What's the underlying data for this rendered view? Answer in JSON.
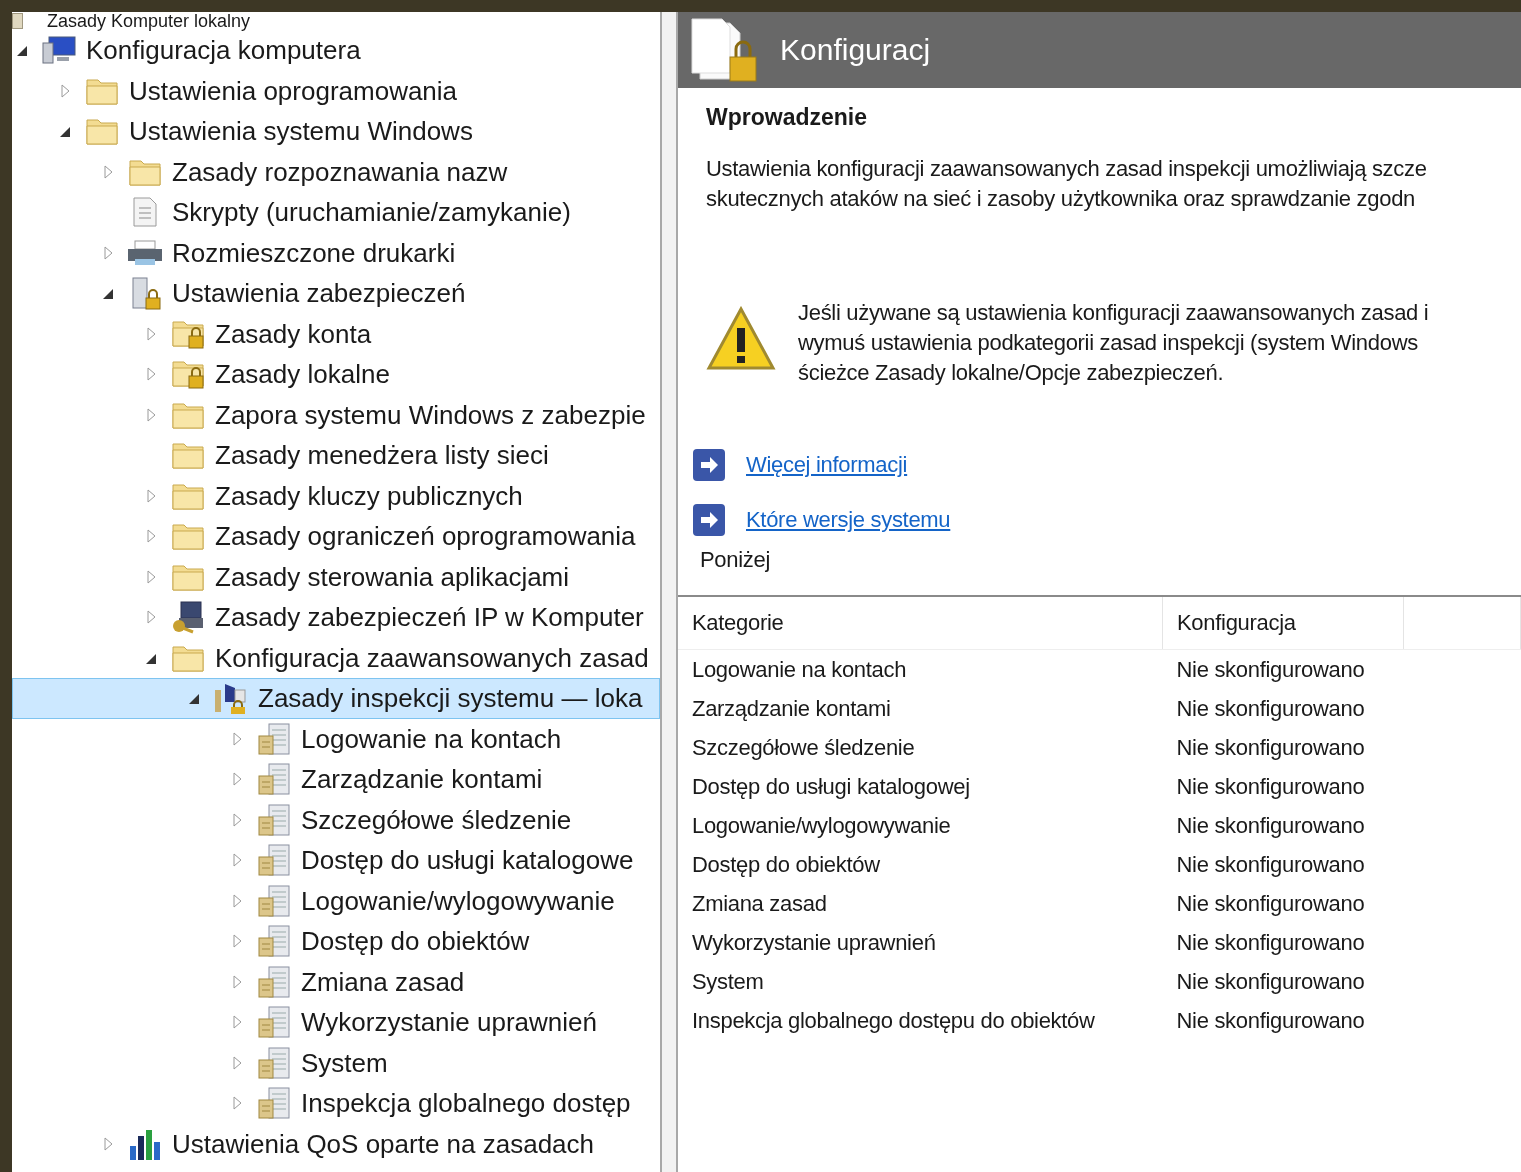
{
  "tree": {
    "root": {
      "label": "Zasady Komputer lokalny"
    },
    "items": [
      {
        "label": "Konfiguracja komputera",
        "kind": "computer",
        "expanded": true,
        "selected": false,
        "children": [
          {
            "label": "Ustawienia oprogramowania",
            "kind": "folder",
            "expanded": false,
            "selected": false
          },
          {
            "label": "Ustawienia systemu Windows",
            "kind": "folder",
            "expanded": true,
            "selected": false,
            "children": [
              {
                "label": "Zasady rozpoznawania nazw",
                "kind": "folder",
                "expanded": false,
                "selected": false
              },
              {
                "label": "Skrypty (uruchamianie/zamykanie)",
                "kind": "script",
                "selected": false
              },
              {
                "label": "Rozmieszczone drukarki",
                "kind": "printer",
                "expanded": false,
                "selected": false
              },
              {
                "label": "Ustawienia zabezpieczeń",
                "kind": "security",
                "expanded": true,
                "selected": false,
                "children": [
                  {
                    "label": "Zasady konta",
                    "kind": "lockedfolder",
                    "expanded": false,
                    "selected": false
                  },
                  {
                    "label": "Zasady lokalne",
                    "kind": "lockedfolder",
                    "expanded": false,
                    "selected": false
                  },
                  {
                    "label": "Zapora systemu Windows z zabezpie",
                    "kind": "folder",
                    "expanded": false,
                    "selected": false
                  },
                  {
                    "label": "Zasady menedżera listy sieci",
                    "kind": "folder",
                    "selected": false
                  },
                  {
                    "label": "Zasady kluczy publicznych",
                    "kind": "folder",
                    "expanded": false,
                    "selected": false
                  },
                  {
                    "label": "Zasady ograniczeń oprogramowania",
                    "kind": "folder",
                    "expanded": false,
                    "selected": false
                  },
                  {
                    "label": "Zasady sterowania aplikacjami",
                    "kind": "folder",
                    "expanded": false,
                    "selected": false
                  },
                  {
                    "label": "Zasady zabezpieczeń IP w Komputer",
                    "kind": "network",
                    "expanded": false,
                    "selected": false
                  },
                  {
                    "label": "Konfiguracja zaawansowanych zasad",
                    "kind": "folder",
                    "expanded": true,
                    "selected": false,
                    "children": [
                      {
                        "label": "Zasady inspekcji systemu — loka",
                        "kind": "audit",
                        "expanded": true,
                        "selected": true,
                        "children": [
                          {
                            "label": "Logowanie na kontach",
                            "kind": "policy",
                            "expanded": false,
                            "selected": false
                          },
                          {
                            "label": "Zarządzanie kontami",
                            "kind": "policy",
                            "expanded": false,
                            "selected": false
                          },
                          {
                            "label": "Szczegółowe śledzenie",
                            "kind": "policy",
                            "expanded": false,
                            "selected": false
                          },
                          {
                            "label": "Dostęp do usługi katalogowe",
                            "kind": "policy",
                            "expanded": false,
                            "selected": false
                          },
                          {
                            "label": "Logowanie/wylogowywanie",
                            "kind": "policy",
                            "expanded": false,
                            "selected": false
                          },
                          {
                            "label": "Dostęp do obiektów",
                            "kind": "policy",
                            "expanded": false,
                            "selected": false
                          },
                          {
                            "label": "Zmiana zasad",
                            "kind": "policy",
                            "expanded": false,
                            "selected": false
                          },
                          {
                            "label": "Wykorzystanie uprawnień",
                            "kind": "policy",
                            "expanded": false,
                            "selected": false
                          },
                          {
                            "label": "System",
                            "kind": "policy",
                            "expanded": false,
                            "selected": false
                          },
                          {
                            "label": "Inspekcja globalnego dostęp",
                            "kind": "policy",
                            "expanded": false,
                            "selected": false
                          }
                        ]
                      }
                    ]
                  }
                ]
              },
              {
                "label": "Ustawienia QoS oparte na zasadach",
                "kind": "chart",
                "expanded": false,
                "selected": false
              }
            ]
          }
        ]
      }
    ]
  },
  "details": {
    "title": "Konfiguracj",
    "heading": "Wprowadzenie",
    "intro_lines": [
      "Ustawienia konfiguracji zaawansowanych zasad inspekcji umożliwiają szcze",
      "skutecznych ataków na sieć i zasoby użytkownika oraz sprawdzanie zgodn"
    ],
    "warning_lines": [
      "Jeśli używane są ustawienia konfiguracji zaawansowanych zasad i",
      "wymuś ustawienia podkategorii zasad inspekcji (system Windows",
      "ścieżce Zasady lokalne/Opcje zabezpieczeń."
    ],
    "links": [
      "Więcej informacji",
      "Które wersje systemu"
    ],
    "below": "Poniżej",
    "table": {
      "columns": [
        "Kategorie",
        "Konfiguracja"
      ],
      "rows": [
        [
          "Logowanie na kontach",
          "Nie skonfigurowano"
        ],
        [
          "Zarządzanie kontami",
          "Nie skonfigurowano"
        ],
        [
          "Szczegółowe śledzenie",
          "Nie skonfigurowano"
        ],
        [
          "Dostęp do usługi katalogowej",
          "Nie skonfigurowano"
        ],
        [
          "Logowanie/wylogowywanie",
          "Nie skonfigurowano"
        ],
        [
          "Dostęp do obiektów",
          "Nie skonfigurowano"
        ],
        [
          "Zmiana zasad",
          "Nie skonfigurowano"
        ],
        [
          "Wykorzystanie uprawnień",
          "Nie skonfigurowano"
        ],
        [
          "System",
          "Nie skonfigurowano"
        ],
        [
          "Inspekcja globalnego dostępu do obiektów",
          "Nie skonfigurowano"
        ]
      ]
    }
  }
}
